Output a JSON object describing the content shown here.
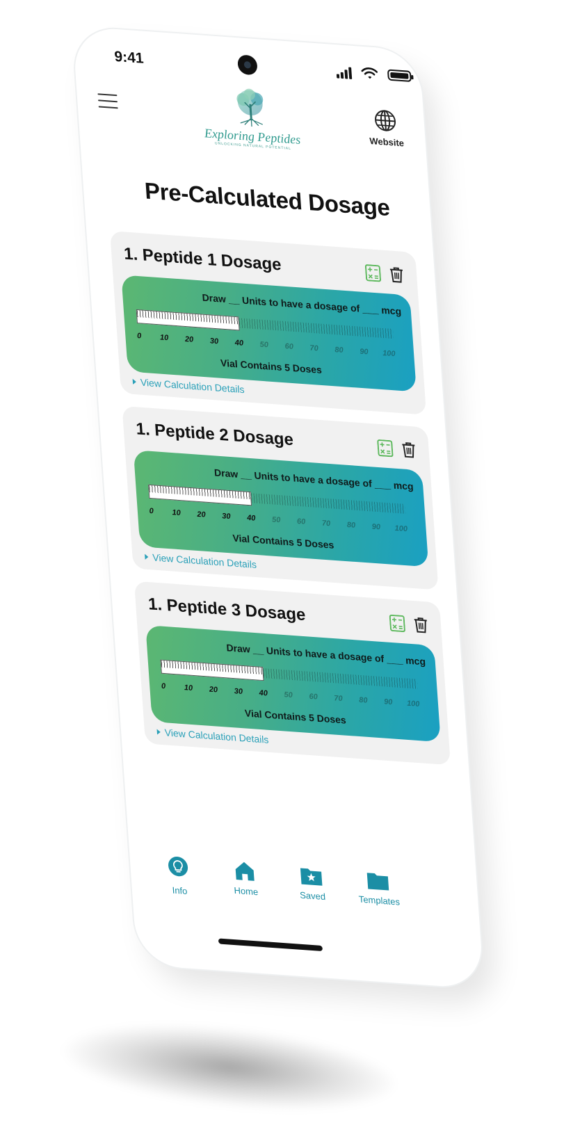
{
  "status_bar": {
    "time": "9:41"
  },
  "header": {
    "logo_name": "Exploring Peptides",
    "logo_tagline": "UNLOCKING NATURAL POTENTIAL",
    "website_label": "Website"
  },
  "page": {
    "title": "Pre-Calculated Dosage"
  },
  "colors": {
    "accent": "#1b8ea5",
    "gradient_start": "#5cb772",
    "gradient_end": "#1aa0c2",
    "card_bg": "#f1f1f1",
    "calc_icon": "#5cb85c"
  },
  "cards": [
    {
      "title": "1. Peptide 1 Dosage",
      "draw_text": "Draw __ Units to have a dosage of ___ mcg",
      "scale": [
        "0",
        "10",
        "20",
        "30",
        "40",
        "50",
        "60",
        "70",
        "80",
        "90",
        "100"
      ],
      "filled_units": 40,
      "vial_text": "Vial Contains 5 Doses",
      "details_label": "View Calculation Details",
      "icons": [
        "calculator-icon",
        "trash-icon"
      ]
    },
    {
      "title": "1. Peptide 2 Dosage",
      "draw_text": "Draw __ Units to have a dosage of ___ mcg",
      "scale": [
        "0",
        "10",
        "20",
        "30",
        "40",
        "50",
        "60",
        "70",
        "80",
        "90",
        "100"
      ],
      "filled_units": 40,
      "vial_text": "Vial Contains 5 Doses",
      "details_label": "View Calculation Details",
      "icons": [
        "calculator-icon",
        "trash-icon"
      ]
    },
    {
      "title": "1. Peptide 3 Dosage",
      "draw_text": "Draw __ Units to have a dosage of ___ mcg",
      "scale": [
        "0",
        "10",
        "20",
        "30",
        "40",
        "50",
        "60",
        "70",
        "80",
        "90",
        "100"
      ],
      "filled_units": 40,
      "vial_text": "Vial Contains 5 Doses",
      "details_label": "View Calculation Details",
      "icons": [
        "calculator-icon",
        "trash-icon"
      ]
    }
  ],
  "tabbar": {
    "items": [
      {
        "label": "Info",
        "icon": "lightbulb-icon"
      },
      {
        "label": "Home",
        "icon": "home-icon"
      },
      {
        "label": "Saved",
        "icon": "saved-folder-icon"
      },
      {
        "label": "Templates",
        "icon": "folder-icon"
      }
    ]
  }
}
